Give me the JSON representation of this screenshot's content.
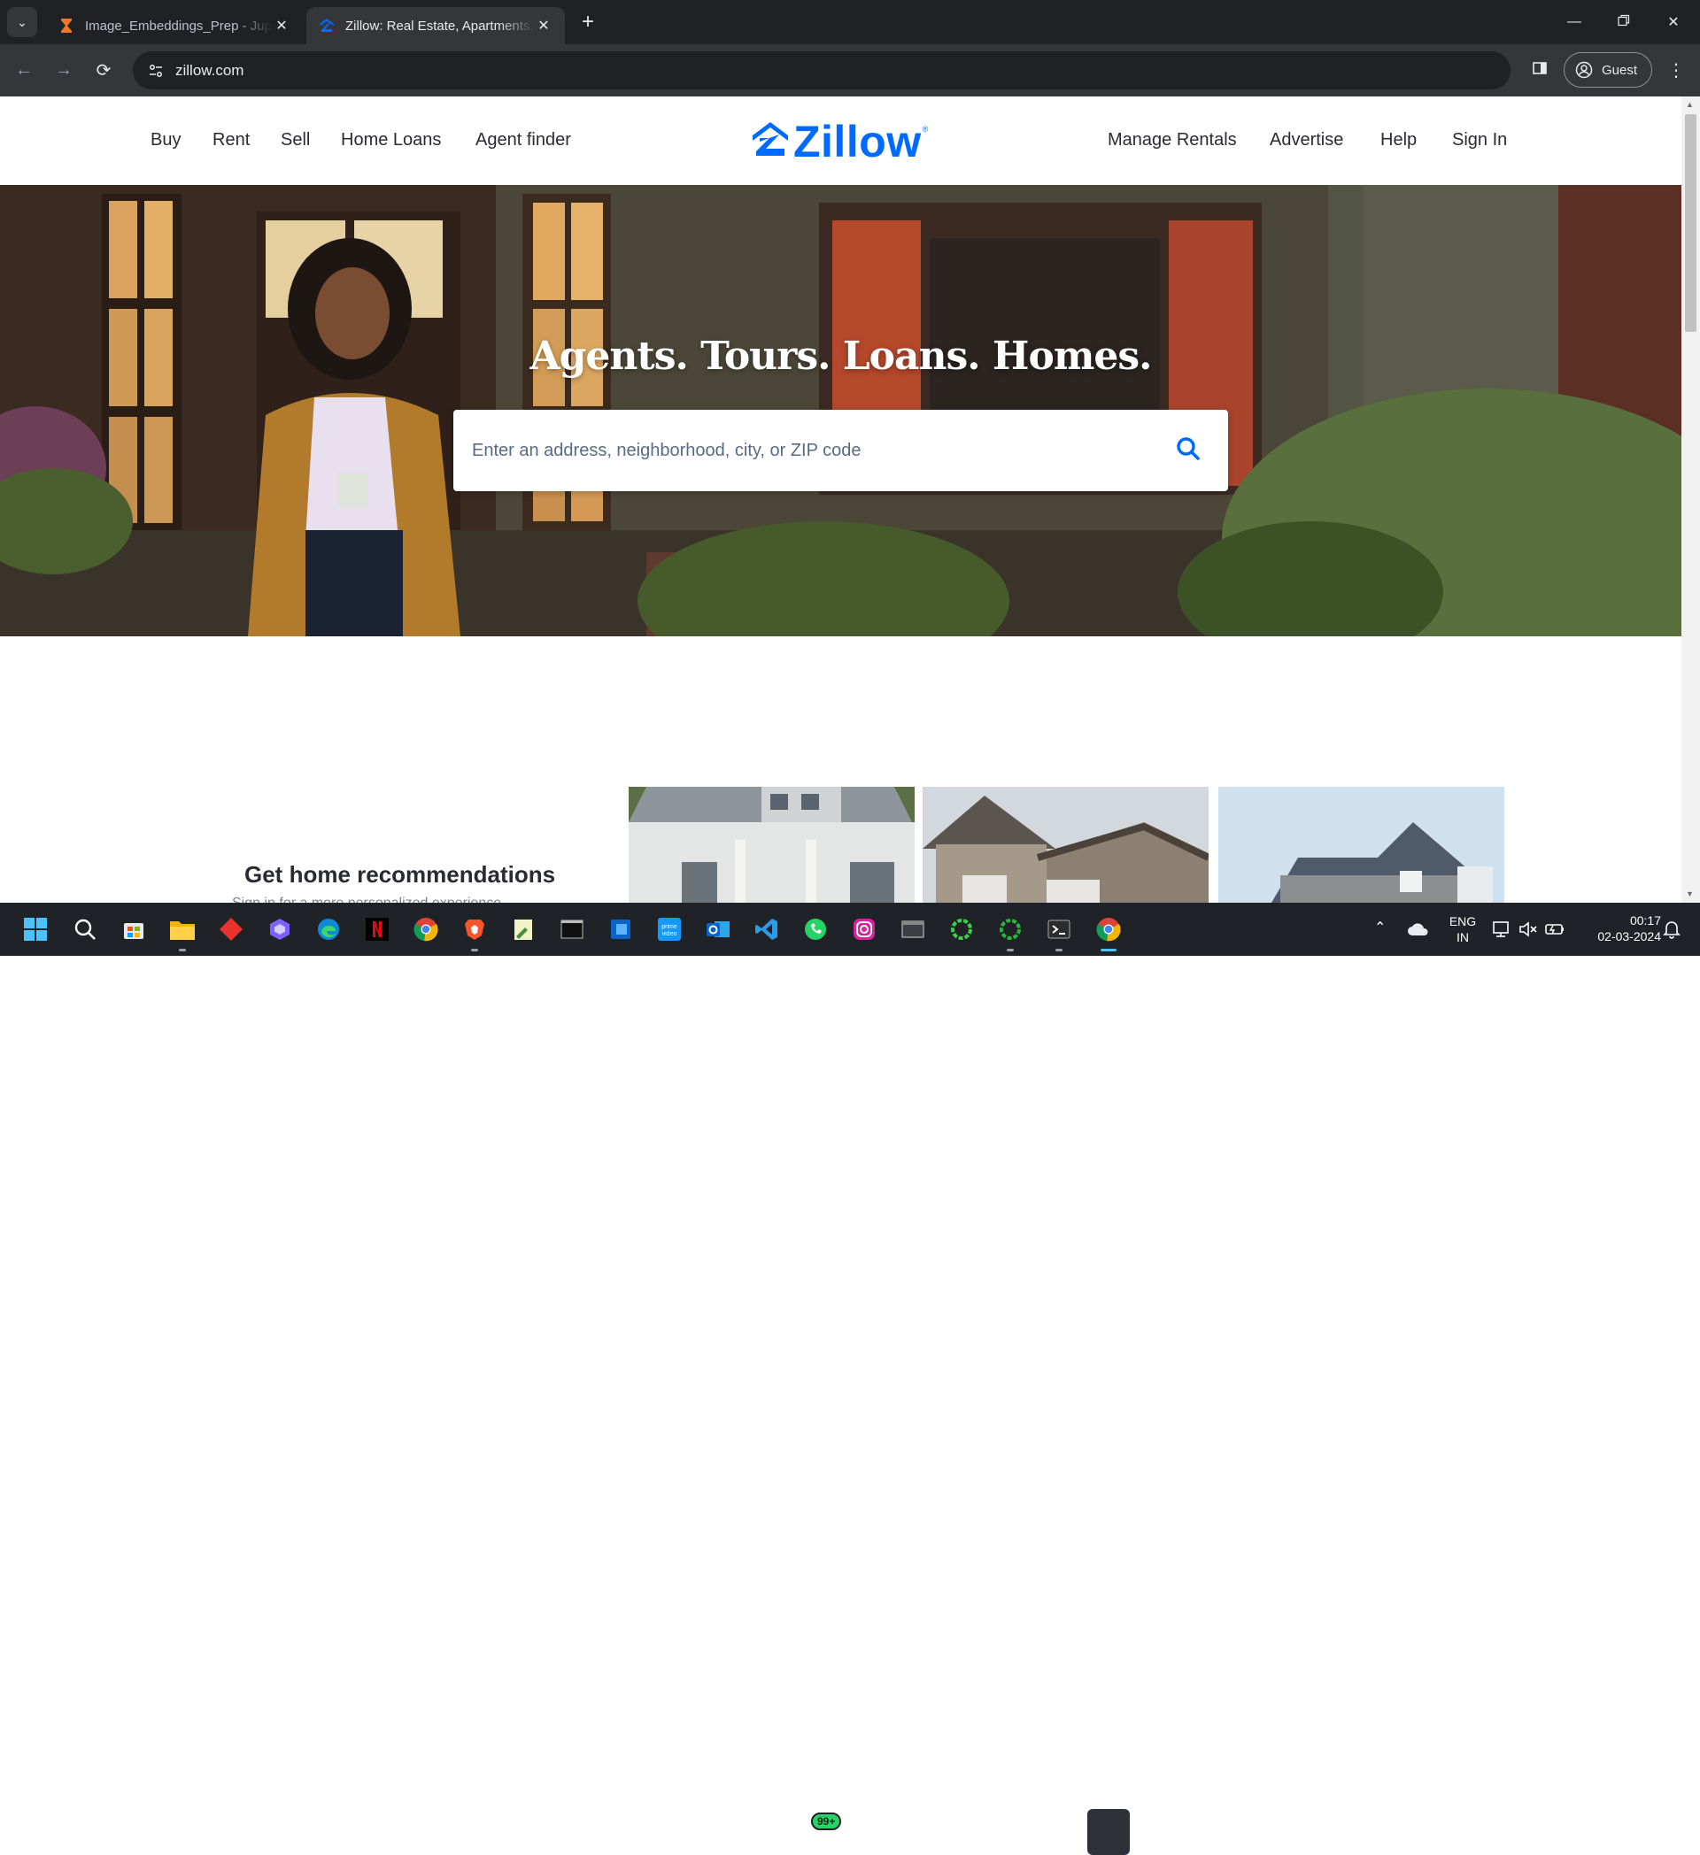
{
  "browser": {
    "tabs": [
      {
        "title": "Image_Embeddings_Prep - Jupyter",
        "icon": "hourglass-icon",
        "active": false
      },
      {
        "title": "Zillow: Real Estate, Apartments,",
        "icon": "zillow-icon",
        "active": true
      }
    ],
    "url": "zillow.com",
    "profile_label": "Guest"
  },
  "site": {
    "nav_left": [
      "Buy",
      "Rent",
      "Sell",
      "Home Loans",
      "Agent finder"
    ],
    "logo_text": "Zillow",
    "logo_mark": "®",
    "nav_right": [
      "Manage Rentals",
      "Advertise",
      "Help",
      "Sign In"
    ],
    "brand_color": "#006aff"
  },
  "hero": {
    "headline": "Agents. Tours. Loans. Homes.",
    "search_placeholder": "Enter an address, neighborhood, city, or ZIP code"
  },
  "recommendations": {
    "title": "Get home recommendations",
    "subtitle": "Sign in for a more personalized experience."
  },
  "taskbar": {
    "apps": [
      "windows-start-icon",
      "search-icon",
      "store-icon",
      "file-explorer-icon",
      "red-diamond-icon",
      "copilot-icon",
      "edge-icon",
      "netflix-icon",
      "chrome-icon",
      "brave-icon",
      "notepad-icon",
      "terminal-dark-icon",
      "word-icon",
      "prime-video-icon",
      "outlook-icon",
      "vscode-icon",
      "whatsapp-icon",
      "instagram-icon",
      "app-window-icon",
      "green-ring-icon",
      "green-ring-2-icon",
      "terminal-icon",
      "chrome-active-icon"
    ],
    "whatsapp_badge": "99+",
    "language": "ENG",
    "region": "IN",
    "time": "00:17",
    "date": "02-03-2024"
  }
}
